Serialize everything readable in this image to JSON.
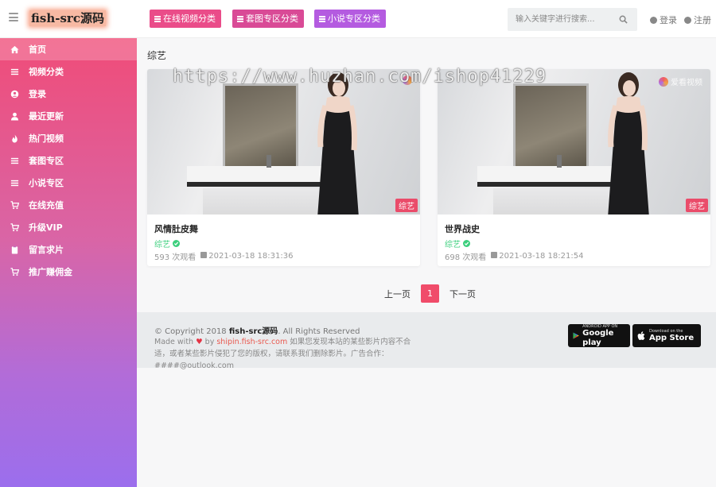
{
  "header": {
    "logo": "fish-src源码",
    "categories": [
      {
        "label": "在线视频分类",
        "color": "#ea4c89"
      },
      {
        "label": "套图专区分类",
        "color": "#d94a96"
      },
      {
        "label": "小说专区分类",
        "color": "#b45be0"
      }
    ],
    "search": {
      "placeholder": "输入关键字进行搜索..."
    },
    "login": "登录",
    "register": "注册"
  },
  "sidebar": {
    "items": [
      {
        "label": "首页",
        "icon": "home-icon",
        "active": true
      },
      {
        "label": "视频分类",
        "icon": "list-icon"
      },
      {
        "label": "登录",
        "icon": "user-circle-icon"
      },
      {
        "label": "最近更新",
        "icon": "user-icon"
      },
      {
        "label": "热门视频",
        "icon": "fire-icon"
      },
      {
        "label": "套图专区",
        "icon": "list-icon"
      },
      {
        "label": "小说专区",
        "icon": "list-icon"
      },
      {
        "label": "在线充值",
        "icon": "cart-icon"
      },
      {
        "label": "升级VIP",
        "icon": "cart-icon"
      },
      {
        "label": "留言求片",
        "icon": "clipboard-icon"
      },
      {
        "label": "推广赚佣金",
        "icon": "cart-icon"
      }
    ]
  },
  "main": {
    "section_title": "综艺",
    "cards": [
      {
        "title": "风情肚皮舞",
        "tag": "综艺",
        "badge": "综艺",
        "views": "593 次观看",
        "date": "2021-03-18 18:31:36"
      },
      {
        "title": "世界战史",
        "tag": "综艺",
        "badge": "综艺",
        "views": "698 次观看",
        "date": "2021-03-18 18:21:54",
        "brand": "爱看视频"
      }
    ]
  },
  "pagination": {
    "prev": "上一页",
    "current": "1",
    "next": "下一页"
  },
  "footer": {
    "copyright_prefix": "© Copyright 2018",
    "copyright_brand": "fish-src源码",
    "copyright_suffix": ". All Rights Reserved",
    "made_with": "Made with",
    "by": "by",
    "site": "shipin.fish-src.com",
    "notice": "如果您发现本站的某些影片内容不合适，或者某些影片侵犯了您的版权，请联系我们删除影片。广告合作：####@outlook.com",
    "google_small": "ANDROID APP ON",
    "google_big": "Google play",
    "apple_small": "Download on the",
    "apple_big": "App Store"
  },
  "watermark": "https://www.huzhan.com/ishop41229"
}
